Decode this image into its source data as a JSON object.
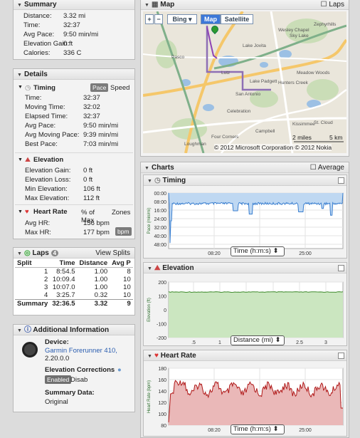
{
  "summary": {
    "title": "Summary",
    "rows": [
      [
        "Distance:",
        "3.32 mi"
      ],
      [
        "Time:",
        "32:37"
      ],
      [
        "Avg Pace:",
        "9:50 min/mi"
      ],
      [
        "Elevation Gain:",
        "0 ft"
      ],
      [
        "Calories:",
        "336 C"
      ]
    ]
  },
  "details": {
    "title": "Details",
    "timing": {
      "title": "Timing",
      "tab_pace": "Pace",
      "tab_speed": "Speed",
      "rows": [
        [
          "Time:",
          "32:37"
        ],
        [
          "Moving Time:",
          "32:02"
        ],
        [
          "Elapsed Time:",
          "32:37"
        ],
        [
          "Avg Pace:",
          "9:50 min/mi"
        ],
        [
          "Avg Moving Pace:",
          "9:39 min/mi"
        ],
        [
          "Best Pace:",
          "7:03 min/mi"
        ]
      ]
    },
    "elevation": {
      "title": "Elevation",
      "rows": [
        [
          "Elevation Gain:",
          "0 ft"
        ],
        [
          "Elevation Loss:",
          "0 ft"
        ],
        [
          "Min Elevation:",
          "106 ft"
        ],
        [
          "Max Elevation:",
          "112 ft"
        ]
      ]
    },
    "heart_rate": {
      "title": "Heart Rate",
      "col_pct": "% of Max",
      "col_zones": "Zones",
      "rows": [
        [
          "Avg HR:",
          "156 bpm"
        ],
        [
          "Max HR:",
          "177 bpm"
        ]
      ],
      "unit_badge": "bpm"
    }
  },
  "laps": {
    "title": "Laps",
    "count": "4",
    "view_splits": "View Splits",
    "headers": [
      "Split",
      "Time",
      "Distance",
      "Avg P"
    ],
    "rows": [
      [
        "1",
        "8:54.5",
        "1.00",
        "8"
      ],
      [
        "2",
        "10:09.4",
        "1.00",
        "10"
      ],
      [
        "3",
        "10:07.0",
        "1.00",
        "10"
      ],
      [
        "4",
        "3:25.7",
        "0.32",
        "10"
      ]
    ],
    "summary": [
      "Summary",
      "32:36.5",
      "3.32",
      "9"
    ]
  },
  "additional": {
    "title": "Additional Information",
    "device_label": "Device:",
    "device_name": "Garmin Forerunner 410,",
    "device_version": "2.20.0.0",
    "elev_corr_label": "Elevation Corrections",
    "enabled": "Enabled",
    "disabled": "Disab",
    "summary_label": "Summary Data:",
    "summary_value": "Original"
  },
  "map": {
    "title": "Map",
    "laps": "Laps",
    "bing": "Bing",
    "map_btn": "Map",
    "satellite_btn": "Satellite",
    "zoom_in": "+",
    "zoom_out": "−",
    "scale_mi": "2 miles",
    "scale_km": "5 km",
    "copyright": "© 2012 Microsoft Corporation  © 2012 Nokia",
    "labels": [
      "Wesley Chapel",
      "Zephyrhills",
      "Sky Lake",
      "Lake Jovita",
      "Pasco",
      "Lutz",
      "San Antonio",
      "Lake Padgett",
      "Celebration",
      "Hunters Creek",
      "Meadow Woods",
      "Kissimmee",
      "Loughman",
      "Campbell",
      "Four Corners",
      "St. Cloud"
    ]
  },
  "charts": {
    "title": "Charts",
    "average": "Average",
    "timing": {
      "title": "Timing",
      "ylabel": "Pace (min/mi)",
      "yticks": [
        "00:00",
        "08:00",
        "16:00",
        "24:00",
        "32:00",
        "40:00",
        "48:00"
      ],
      "xticks": [
        "08:20",
        "16:40",
        "25:00"
      ],
      "axis_select": "Time (h:m:s)"
    },
    "elevation": {
      "title": "Elevation",
      "ylabel": "Elevation (ft)",
      "yticks": [
        "200",
        "100",
        "0",
        "-100",
        "-200"
      ],
      "xticks": [
        ".5",
        "1",
        "1.5",
        "2",
        "2.5",
        "3"
      ],
      "axis_select": "Distance (mi)"
    },
    "heart_rate": {
      "title": "Heart Rate",
      "ylabel": "Heart Rate (bpm)",
      "yticks": [
        "180",
        "160",
        "140",
        "120",
        "100",
        "80"
      ],
      "xticks": [
        "08:20",
        "16:40",
        "25:00"
      ],
      "axis_select": "Time (h:m:s)"
    }
  },
  "colors": {
    "pace": "#3a7fd0",
    "pace_fill": "#bfd8f2",
    "elev": "#3d8a2a",
    "elev_fill": "#cbe6c0",
    "hr": "#b01818",
    "hr_fill": "#eab8b8"
  }
}
